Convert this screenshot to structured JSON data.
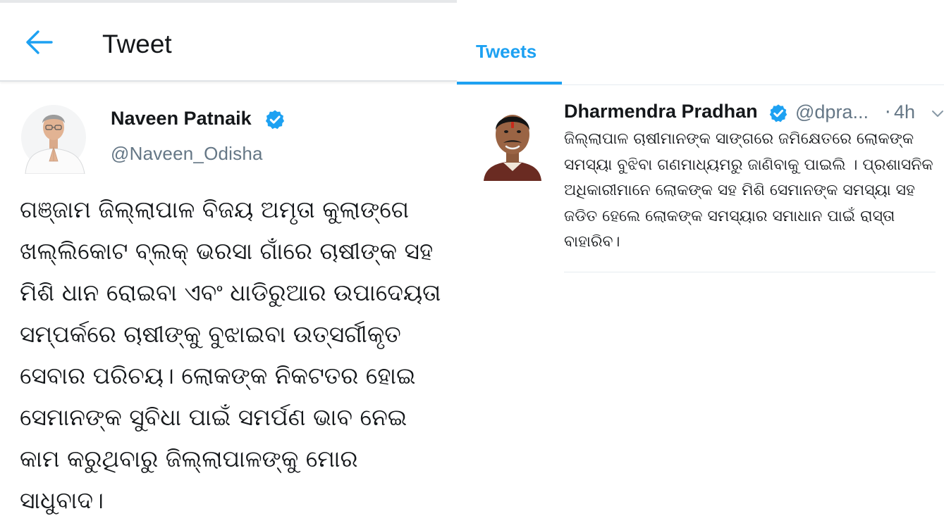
{
  "left_panel": {
    "header": {
      "title": "Tweet"
    },
    "author": {
      "name": "Naveen Patnaik",
      "handle": "@Naveen_Odisha"
    },
    "tweet_text": "ଗଞ୍ଜାମ ଜିଲ୍ଲାପାଳ ବିଜୟ ଅମୃତା କୁଲାଙ୍ଗେ ଖଲ୍ଲିକୋଟ ବ୍ଲକ୍ ଭରସା ଗାଁରେ ଚାଷୀଙ୍କ ସହ ମିଶି ଧାନ ରୋଇବା ଏବଂ ଧାଡିରୁଆର ଉପାଦେୟତା ସମ୍ପର୍କରେ ଚାଷୀଙ୍କୁ ବୁଝାଇବା ଉତ୍ସର୍ଗୀକୃତ ସେବାର ପରିଚୟ। ଲୋକଙ୍କ ନିକଟତର ହୋଇ ସେମାନଙ୍କ ସୁବିଧା ପାଇଁ ସମର୍ପଣ ଭାବ ନେଇ କାମ କରୁଥିବାରୁ ଜିଲ୍ଲାପାଳଙ୍କୁ ମୋର ସାଧୁବାଦ।"
  },
  "right_panel": {
    "tab_label": "Tweets",
    "tweet": {
      "author_name": "Dharmendra Pradhan",
      "handle": "@dpra...",
      "separator": "·",
      "time": "4h",
      "text": "ଜିଲ୍ଲାପାଳ ଚାଷୀମାନଙ୍କ ସାଙ୍ଗରେ ଜମିକ୍ଷେତରେ ଲୋକଙ୍କ ସମସ୍ୟା ବୁଝିବା ଗଣମାଧ୍ୟମରୁ ଜାଣିବାକୁ ପାଇଲି । ପ୍ରଶାସନିକ ଅଧିକାରୀମାନେ ଲୋକଙ୍କ ସହ ମିଶି ସେମାନଙ୍କ ସମସ୍ୟା ସହ ଜଡିତ ହେଲେ ଲୋକଙ୍କ ସମସ୍ୟାର ସମାଧାନ ପାଇଁ ରାସ୍ତା ବାହାରିବ।"
    }
  },
  "icons": {
    "back": "arrow-left-icon",
    "verified": "verified-badge-icon",
    "more": "chevron-down-icon"
  },
  "colors": {
    "accent": "#1da1f2",
    "text": "#14171a",
    "secondary_text": "#657786",
    "divider": "#e6ecf0"
  }
}
